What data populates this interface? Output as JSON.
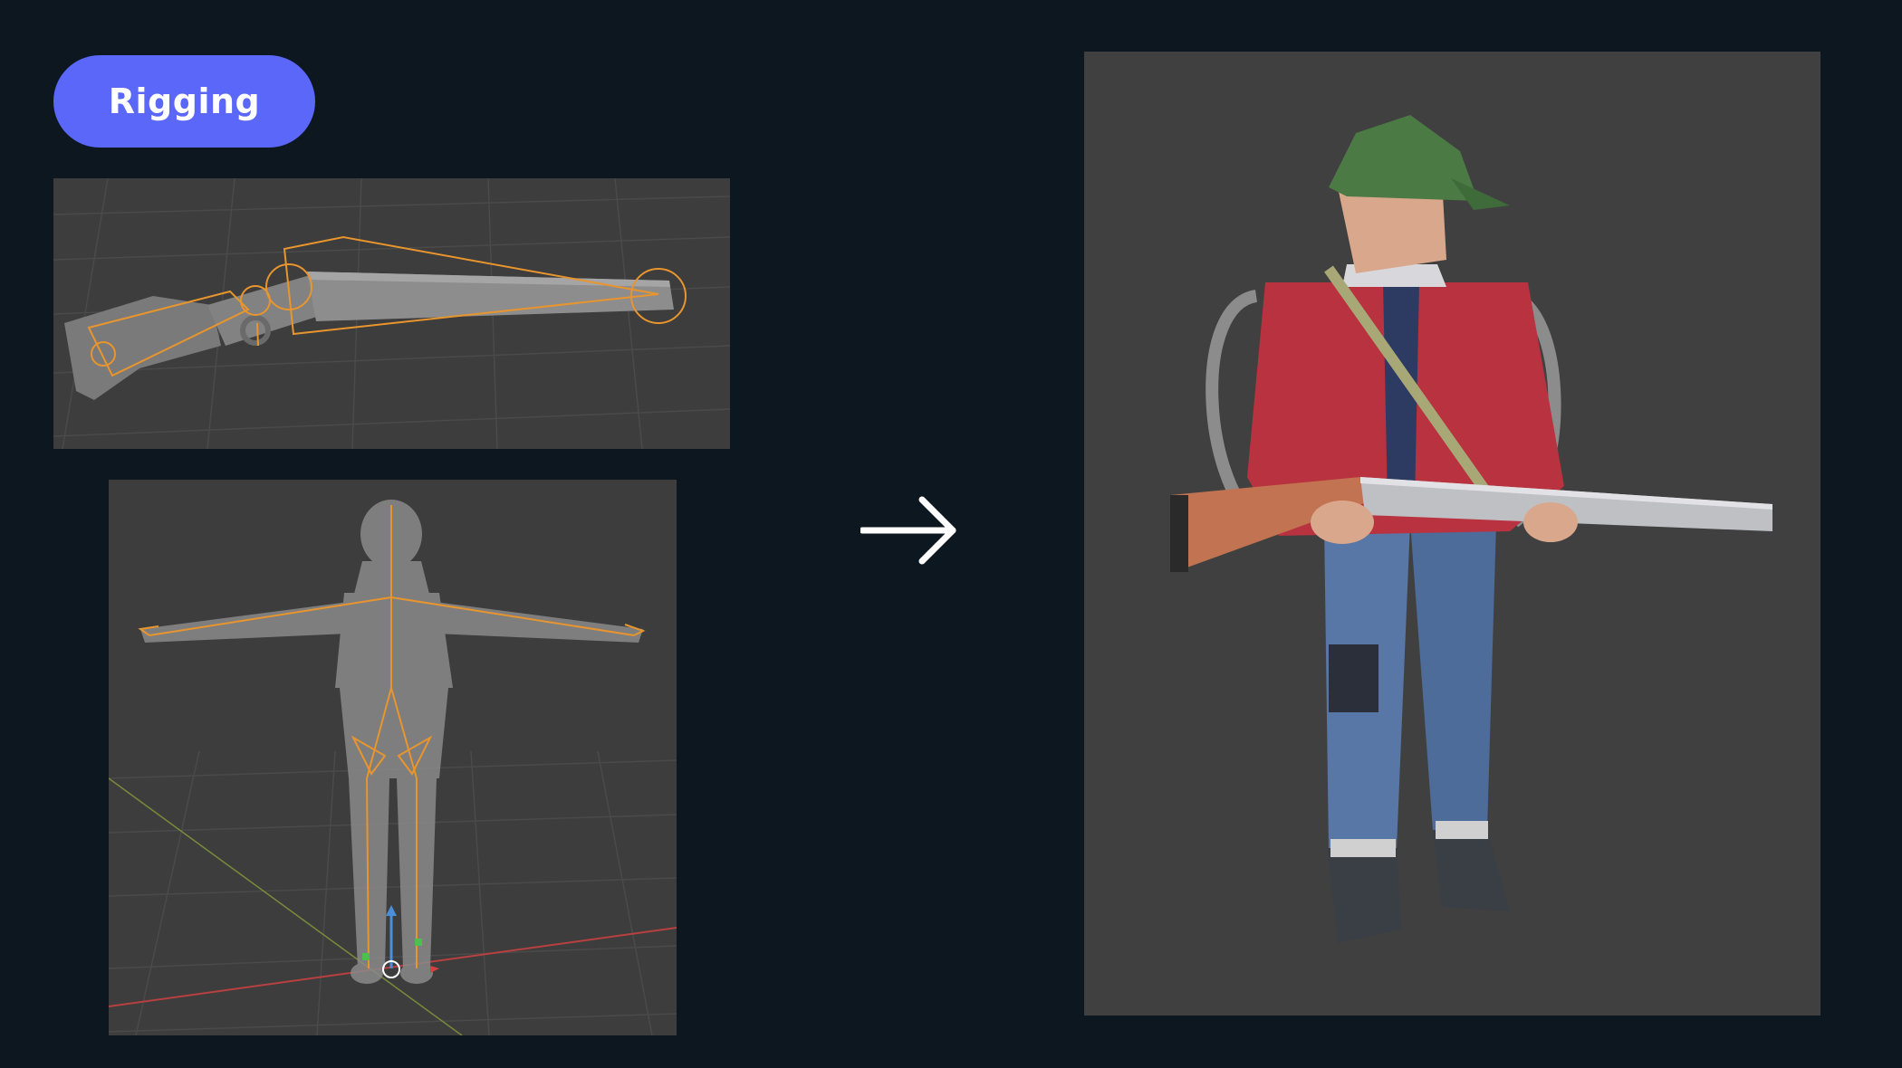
{
  "badge": {
    "label": "Rigging"
  },
  "icons": {
    "arrow": "arrow-right-icon"
  },
  "colors": {
    "background": "#0c1720",
    "badge": "#5a67f8",
    "viewport": "#3d3d3d",
    "bone": "#e8952e"
  },
  "panels": [
    {
      "name": "shotgun-rig-viewport"
    },
    {
      "name": "character-rig-viewport"
    },
    {
      "name": "final-render-viewport"
    }
  ]
}
